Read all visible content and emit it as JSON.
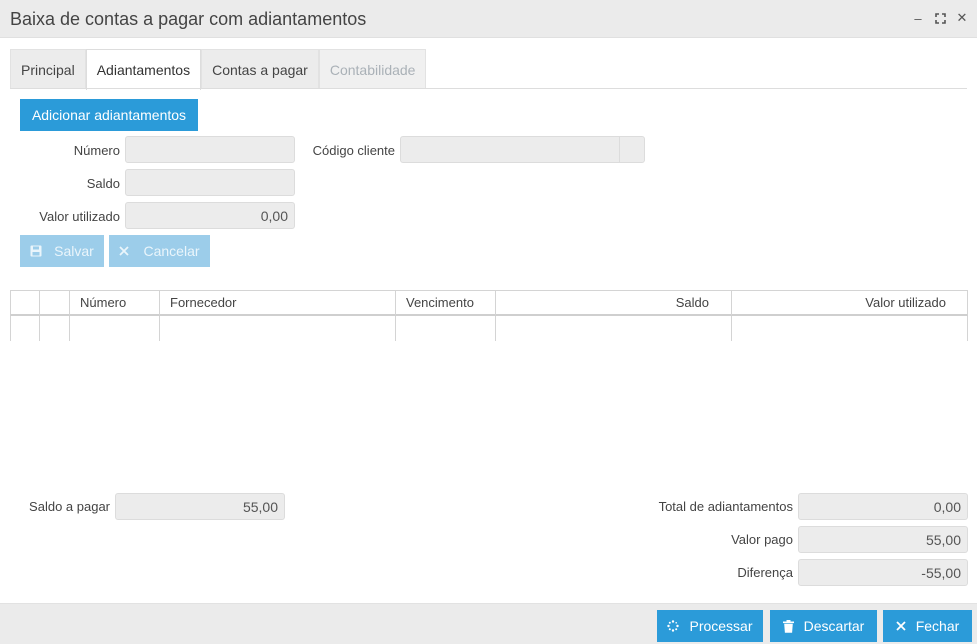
{
  "window": {
    "title": "Baixa de contas a pagar com adiantamentos",
    "controls": {
      "minimize": "–",
      "maximize": "⛶",
      "close": "✕"
    }
  },
  "tabs": [
    {
      "label": "Principal",
      "state": "normal"
    },
    {
      "label": "Adiantamentos",
      "state": "active"
    },
    {
      "label": "Contas a pagar",
      "state": "normal"
    },
    {
      "label": "Contabilidade",
      "state": "disabled"
    }
  ],
  "advance_form": {
    "add_button": "Adicionar adiantamentos",
    "numero_label": "Número",
    "numero_value": "",
    "codigo_cliente_label": "Código cliente",
    "codigo_cliente_value": "",
    "saldo_label": "Saldo",
    "saldo_value": "",
    "valor_utilizado_label": "Valor utilizado",
    "valor_utilizado_value": "0,00",
    "save_button": "Salvar",
    "cancel_button": "Cancelar"
  },
  "grid": {
    "columns": [
      "",
      "",
      "Número",
      "Fornecedor",
      "Vencimento",
      "Saldo",
      "Valor utilizado"
    ],
    "rows": []
  },
  "summary": {
    "saldo_a_pagar_label": "Saldo a pagar",
    "saldo_a_pagar_value": "55,00",
    "total_adiantamentos_label": "Total de adiantamentos",
    "total_adiantamentos_value": "0,00",
    "valor_pago_label": "Valor pago",
    "valor_pago_value": "55,00",
    "diferenca_label": "Diferença",
    "diferenca_value": "-55,00"
  },
  "footer": {
    "processar": "Processar",
    "descartar": "Descartar",
    "fechar": "Fechar"
  },
  "colors": {
    "primary": "#2b9bd9",
    "primary_disabled": "#9ccdea",
    "titlebar": "#ebebeb",
    "field": "#ececec"
  }
}
